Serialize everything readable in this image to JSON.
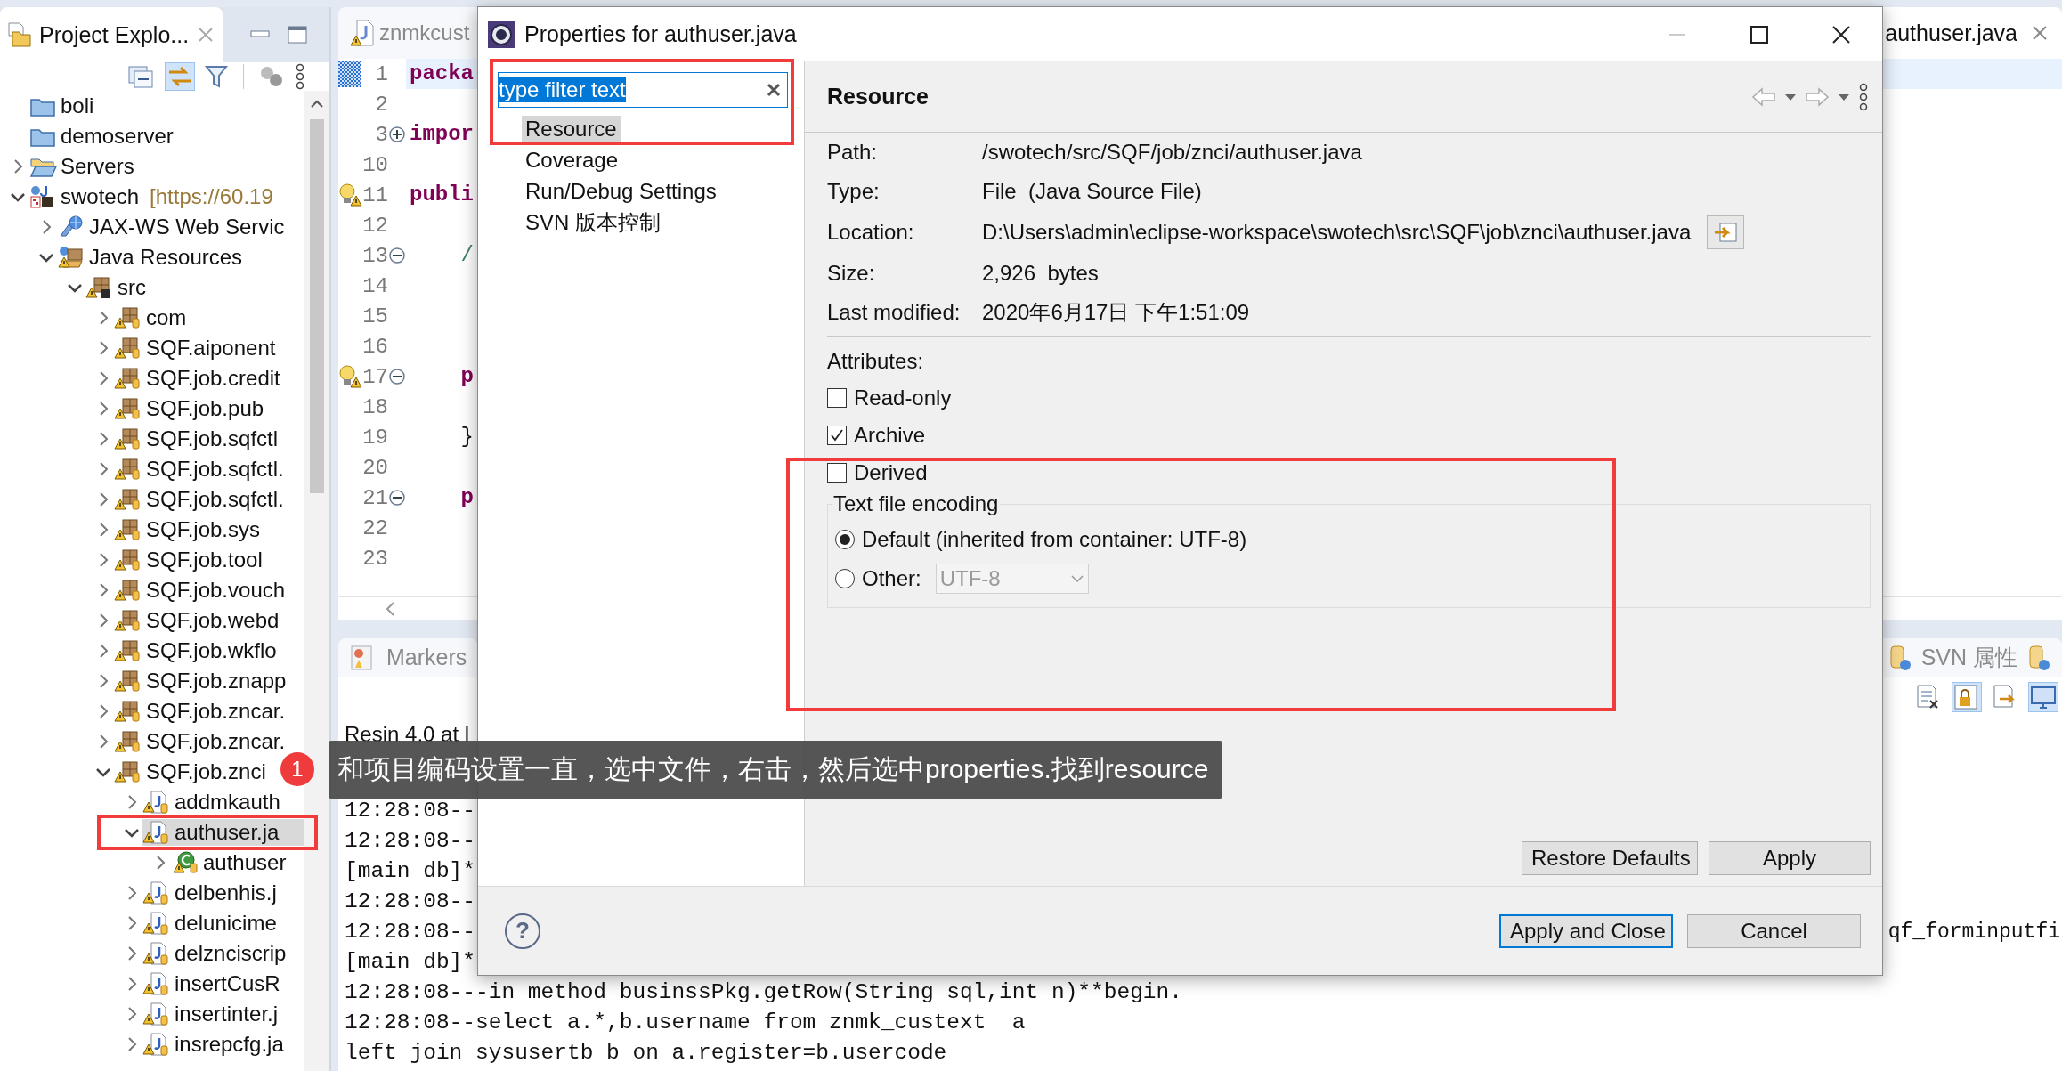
{
  "explorer": {
    "title": "Project Explo...",
    "tree": [
      {
        "label": "boli",
        "kind": "folder",
        "selected": false
      },
      {
        "label": "demoserver",
        "kind": "folder",
        "selected": false
      },
      {
        "label": "Servers",
        "kind": "open-folder",
        "expanded": false,
        "selected": false
      },
      {
        "label": "swotech",
        "decoration": "[https://60.19",
        "kind": "project",
        "expanded": true,
        "selected": false,
        "children": [
          {
            "label": "JAX-WS Web Servic",
            "kind": "web-services",
            "expanded": false,
            "selected": false
          },
          {
            "label": "Java Resources",
            "kind": "java-resources",
            "expanded": true,
            "selected": false,
            "children": [
              {
                "label": "src",
                "kind": "source-folder",
                "expanded": true,
                "selected": false,
                "children": [
                  {
                    "label": "com",
                    "kind": "package",
                    "expanded": false,
                    "selected": false
                  },
                  {
                    "label": "SQF.aiponent",
                    "kind": "package",
                    "expanded": false,
                    "selected": false
                  },
                  {
                    "label": "SQF.job.credit",
                    "kind": "package",
                    "expanded": false,
                    "selected": false
                  },
                  {
                    "label": "SQF.job.pub",
                    "kind": "package",
                    "expanded": false,
                    "selected": false
                  },
                  {
                    "label": "SQF.job.sqfctl",
                    "kind": "package",
                    "expanded": false,
                    "selected": false
                  },
                  {
                    "label": "SQF.job.sqfctl.",
                    "kind": "package",
                    "expanded": false,
                    "selected": false
                  },
                  {
                    "label": "SQF.job.sqfctl.",
                    "kind": "package",
                    "expanded": false,
                    "selected": false
                  },
                  {
                    "label": "SQF.job.sys",
                    "kind": "package",
                    "expanded": false,
                    "selected": false
                  },
                  {
                    "label": "SQF.job.tool",
                    "kind": "package",
                    "expanded": false,
                    "selected": false
                  },
                  {
                    "label": "SQF.job.vouch",
                    "kind": "package",
                    "expanded": false,
                    "selected": false
                  },
                  {
                    "label": "SQF.job.webd",
                    "kind": "package",
                    "expanded": false,
                    "selected": false
                  },
                  {
                    "label": "SQF.job.wkflo",
                    "kind": "package",
                    "expanded": false,
                    "selected": false
                  },
                  {
                    "label": "SQF.job.znapp",
                    "kind": "package",
                    "expanded": false,
                    "selected": false
                  },
                  {
                    "label": "SQF.job.zncar.",
                    "kind": "package",
                    "expanded": false,
                    "selected": false
                  },
                  {
                    "label": "SQF.job.zncar.",
                    "kind": "package",
                    "expanded": false,
                    "selected": false
                  },
                  {
                    "label": "SQF.job.znci",
                    "kind": "package",
                    "expanded": true,
                    "selected": false,
                    "children": [
                      {
                        "label": "addmkauth",
                        "kind": "java-file",
                        "expanded": false,
                        "selected": false
                      },
                      {
                        "label": "authuser.ja",
                        "kind": "java-file",
                        "expanded": true,
                        "selected": true,
                        "children": [
                          {
                            "label": "authuser",
                            "kind": "class",
                            "expanded": false,
                            "selected": false
                          }
                        ]
                      },
                      {
                        "label": "delbenhis.j",
                        "kind": "java-file",
                        "expanded": false,
                        "selected": false
                      },
                      {
                        "label": "delunicime",
                        "kind": "java-file",
                        "expanded": false,
                        "selected": false
                      },
                      {
                        "label": "delznciscrip",
                        "kind": "java-file",
                        "expanded": false,
                        "selected": false
                      },
                      {
                        "label": "insertCusR",
                        "kind": "java-file",
                        "expanded": false,
                        "selected": false
                      },
                      {
                        "label": "insertinter.j",
                        "kind": "java-file",
                        "expanded": false,
                        "selected": false
                      },
                      {
                        "label": "insrepcfg.ja",
                        "kind": "java-file",
                        "expanded": false,
                        "selected": false
                      }
                    ]
                  }
                ]
              }
            ]
          }
        ]
      }
    ]
  },
  "editor": {
    "tab": "znmkcust",
    "right_tab": "authuser.java",
    "lines": [
      {
        "number": "1",
        "code": "packa",
        "kind": "keyword",
        "current": true,
        "warning": false
      },
      {
        "number": "2",
        "current": false,
        "warning": false
      },
      {
        "number": "3",
        "code": "impor",
        "kind": "keyword",
        "folded": true,
        "current": false,
        "warning": false
      },
      {
        "number": "10",
        "current": false,
        "warning": false
      },
      {
        "number": "11",
        "code": "publi",
        "kind": "keyword",
        "current": false,
        "warning": true
      },
      {
        "number": "12",
        "current": false,
        "warning": false
      },
      {
        "number": "13",
        "code": "    /",
        "kind": "comment",
        "folded": false,
        "current": false,
        "warning": false
      },
      {
        "number": "14",
        "current": false,
        "warning": false
      },
      {
        "number": "15",
        "current": false,
        "warning": false
      },
      {
        "number": "16",
        "current": false,
        "warning": false
      },
      {
        "number": "17",
        "code": "    p",
        "kind": "keyword",
        "folded": false,
        "current": false,
        "warning": true
      },
      {
        "number": "18",
        "current": false,
        "warning": false
      },
      {
        "number": "19",
        "code": "    }",
        "kind": "plain",
        "current": false,
        "warning": false
      },
      {
        "number": "20",
        "current": false,
        "warning": false
      },
      {
        "number": "21",
        "code": "    p",
        "kind": "keyword",
        "folded": false,
        "current": false,
        "warning": false
      },
      {
        "number": "22",
        "current": false,
        "warning": false
      },
      {
        "number": "23",
        "current": false,
        "warning": false
      }
    ]
  },
  "bottom_panel": {
    "left_tab": "Markers",
    "right_tab": "SVN 属性"
  },
  "console": {
    "header": "Resin 4.0 at l",
    "lines": [
      {
        "text": "12:28:08--"
      },
      {
        "text": "12:28:08--"
      },
      {
        "text": "[main db]*"
      },
      {
        "text": "12:28:08--"
      },
      {
        "text": "12:28:08--",
        "right": "qf_forminputfi"
      },
      {
        "text": "[main db]*"
      },
      {
        "text": "12:28:08---in method businssPkg.getRow(String sql,int n)**begin."
      },
      {
        "text": "12:28:08--select a.*,b.username from znmk_custext  a"
      },
      {
        "text": "left join sysusertb b on a.register=b.usercode"
      }
    ]
  },
  "dialog": {
    "title": "Properties for authuser.java",
    "filter": {
      "value": "type filter text"
    },
    "nav": [
      {
        "label": "Resource",
        "selected": true
      },
      {
        "label": "Coverage",
        "selected": false
      },
      {
        "label": "Run/Debug Settings",
        "selected": false
      },
      {
        "label": "SVN 版本控制",
        "selected": false
      }
    ],
    "page_title": "Resource",
    "properties": [
      {
        "label": "Path:",
        "value": "/swotech/src/SQF/job/znci/authuser.java",
        "kind": "plain"
      },
      {
        "label": "Type:",
        "value": "File  (Java Source File)",
        "kind": "plain"
      },
      {
        "label": "Location:",
        "value": "D:\\Users\\admin\\eclipse-workspace\\swotech\\src\\SQF\\job\\znci\\authuser.java",
        "kind": "location"
      },
      {
        "label": "Size:",
        "value": "2,926  bytes",
        "kind": "plain"
      },
      {
        "label": "Last modified:",
        "value": "2020年6月17日 下午1:51:09",
        "kind": "plain"
      }
    ],
    "attributes": {
      "label": "Attributes:",
      "options": [
        {
          "label": "Read-only",
          "checked": false
        },
        {
          "label": "Archive",
          "checked": true
        },
        {
          "label": "Derived",
          "checked": false
        }
      ]
    },
    "encoding": {
      "label": "Text file encoding",
      "options": [
        {
          "label": "Default (inherited from container: UTF-8)",
          "selected": true
        },
        {
          "label": "Other:",
          "selected": false,
          "combo": {
            "value": "UTF-8",
            "disabled": true
          }
        }
      ]
    },
    "page_buttons": [
      {
        "label": "Restore Defaults",
        "default": false
      },
      {
        "label": "Apply",
        "default": false
      }
    ],
    "help": "?",
    "buttons": [
      {
        "label": "Apply and Close",
        "default": true
      },
      {
        "label": "Cancel",
        "default": false
      }
    ]
  },
  "tooltip": {
    "badge": "1",
    "text": "和项目编码设置一直，选中文件，右击，然后选中properties.找到resource"
  }
}
